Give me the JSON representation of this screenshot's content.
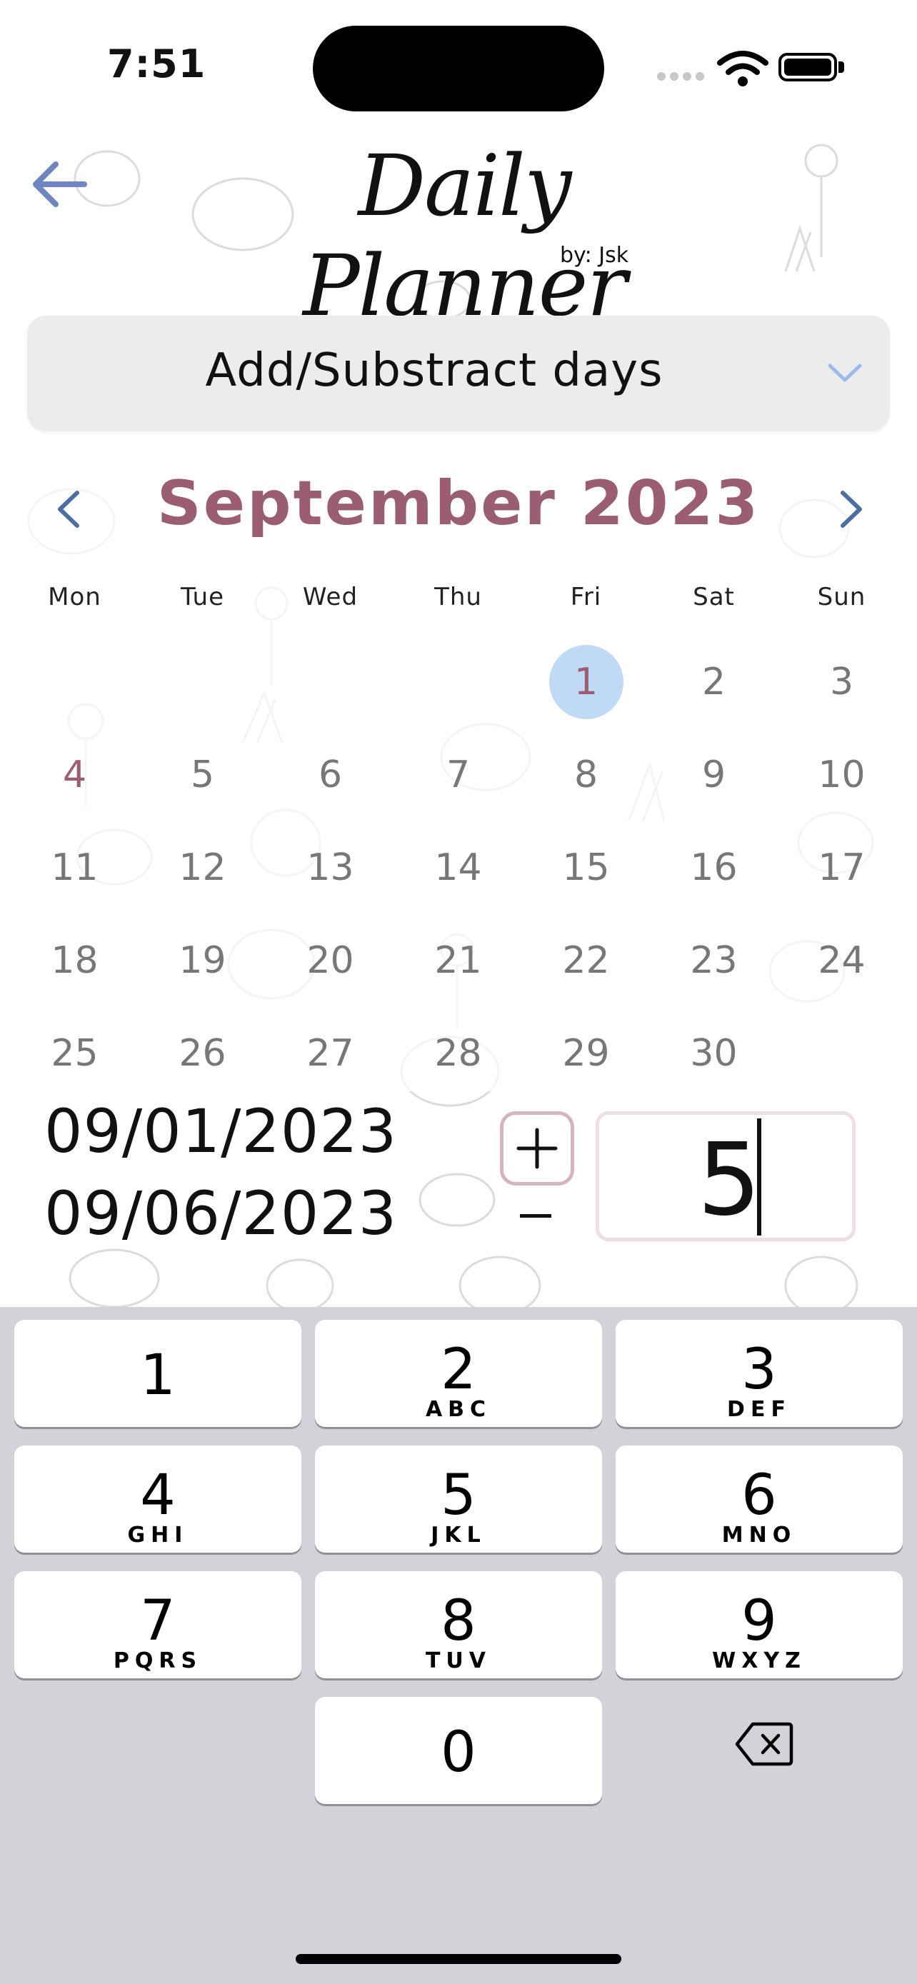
{
  "status_bar": {
    "time": "7:51"
  },
  "header": {
    "title": "Daily Planner",
    "subtitle": "by: Jsk"
  },
  "dropdown": {
    "selected": "Add/Substract days"
  },
  "calendar": {
    "month_title": "September 2023",
    "weekdays": [
      "Mon",
      "Tue",
      "Wed",
      "Thu",
      "Fri",
      "Sat",
      "Sun"
    ],
    "weeks": [
      [
        "",
        "",
        "",
        "",
        "1",
        "2",
        "3"
      ],
      [
        "4",
        "5",
        "6",
        "7",
        "8",
        "9",
        "10"
      ],
      [
        "11",
        "12",
        "13",
        "14",
        "15",
        "16",
        "17"
      ],
      [
        "18",
        "19",
        "20",
        "21",
        "22",
        "23",
        "24"
      ],
      [
        "25",
        "26",
        "27",
        "28",
        "29",
        "30",
        ""
      ]
    ],
    "selected_day": "1",
    "highlighted_day": "4"
  },
  "calc": {
    "start_date": "09/01/2023",
    "result_date": "09/06/2023",
    "plus": "+",
    "days_value": "5"
  },
  "keyboard": {
    "keys": [
      {
        "digit": "1",
        "letters": ""
      },
      {
        "digit": "2",
        "letters": "ABC"
      },
      {
        "digit": "3",
        "letters": "DEF"
      },
      {
        "digit": "4",
        "letters": "GHI"
      },
      {
        "digit": "5",
        "letters": "JKL"
      },
      {
        "digit": "6",
        "letters": "MNO"
      },
      {
        "digit": "7",
        "letters": "PQRS"
      },
      {
        "digit": "8",
        "letters": "TUV"
      },
      {
        "digit": "9",
        "letters": "WXYZ"
      },
      {
        "digit": "0",
        "letters": ""
      }
    ]
  },
  "colors": {
    "accent": "#9b5d72",
    "selected": "#c0d9f5",
    "nav": "#4a6fa5",
    "back": "#6f86c2"
  }
}
